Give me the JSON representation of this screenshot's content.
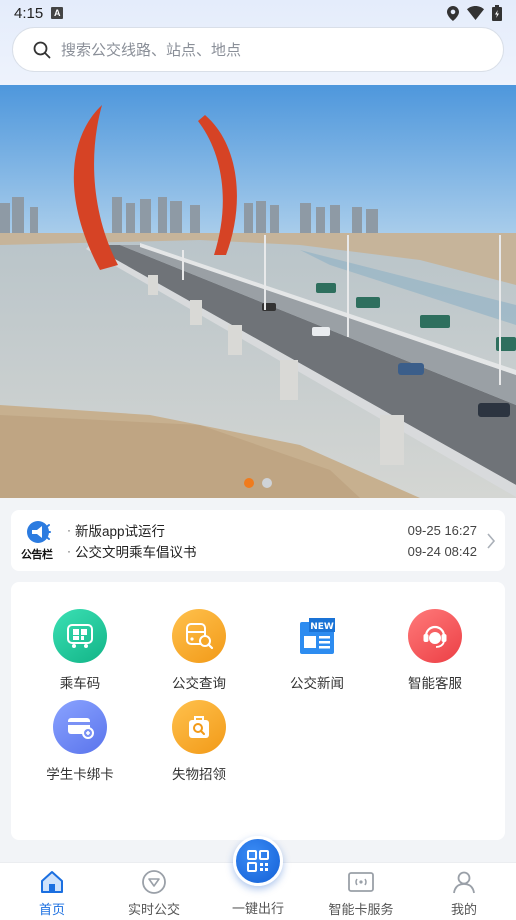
{
  "status_bar": {
    "time": "4:15",
    "notif_letter": "A"
  },
  "search": {
    "placeholder": "搜索公交线路、站点、地点"
  },
  "banner": {
    "slides": 2,
    "active_index": 0
  },
  "notice": {
    "logo_label": "公告栏",
    "items": [
      {
        "title": "新版app试运行",
        "date": "09-25 16:27"
      },
      {
        "title": "公交文明乘车倡议书",
        "date": "09-24 08:42"
      }
    ]
  },
  "services": [
    {
      "label": "乘车码",
      "icon": "ride-code-icon",
      "color": "#18c79a"
    },
    {
      "label": "公交查询",
      "icon": "bus-search-icon",
      "color": "#f5a623"
    },
    {
      "label": "公交新闻",
      "icon": "news-icon",
      "color": "#2d8cf0"
    },
    {
      "label": "智能客服",
      "icon": "customer-service-icon",
      "color": "#f0484b"
    },
    {
      "label": "学生卡绑卡",
      "icon": "student-card-icon",
      "color": "#5f7cf0"
    },
    {
      "label": "失物招领",
      "icon": "lost-found-icon",
      "color": "#f5a623"
    }
  ],
  "tabbar": {
    "items": [
      {
        "label": "首页",
        "icon": "home-icon",
        "active": true
      },
      {
        "label": "实时公交",
        "icon": "realtime-bus-icon",
        "active": false
      },
      {
        "label": "一键出行",
        "icon": "qr-code-icon",
        "active": false
      },
      {
        "label": "智能卡服务",
        "icon": "smart-card-icon",
        "active": false
      },
      {
        "label": "我的",
        "icon": "profile-icon",
        "active": false
      }
    ]
  },
  "colors": {
    "accent": "#1b6fe0",
    "dot_active": "#f07b1d"
  }
}
